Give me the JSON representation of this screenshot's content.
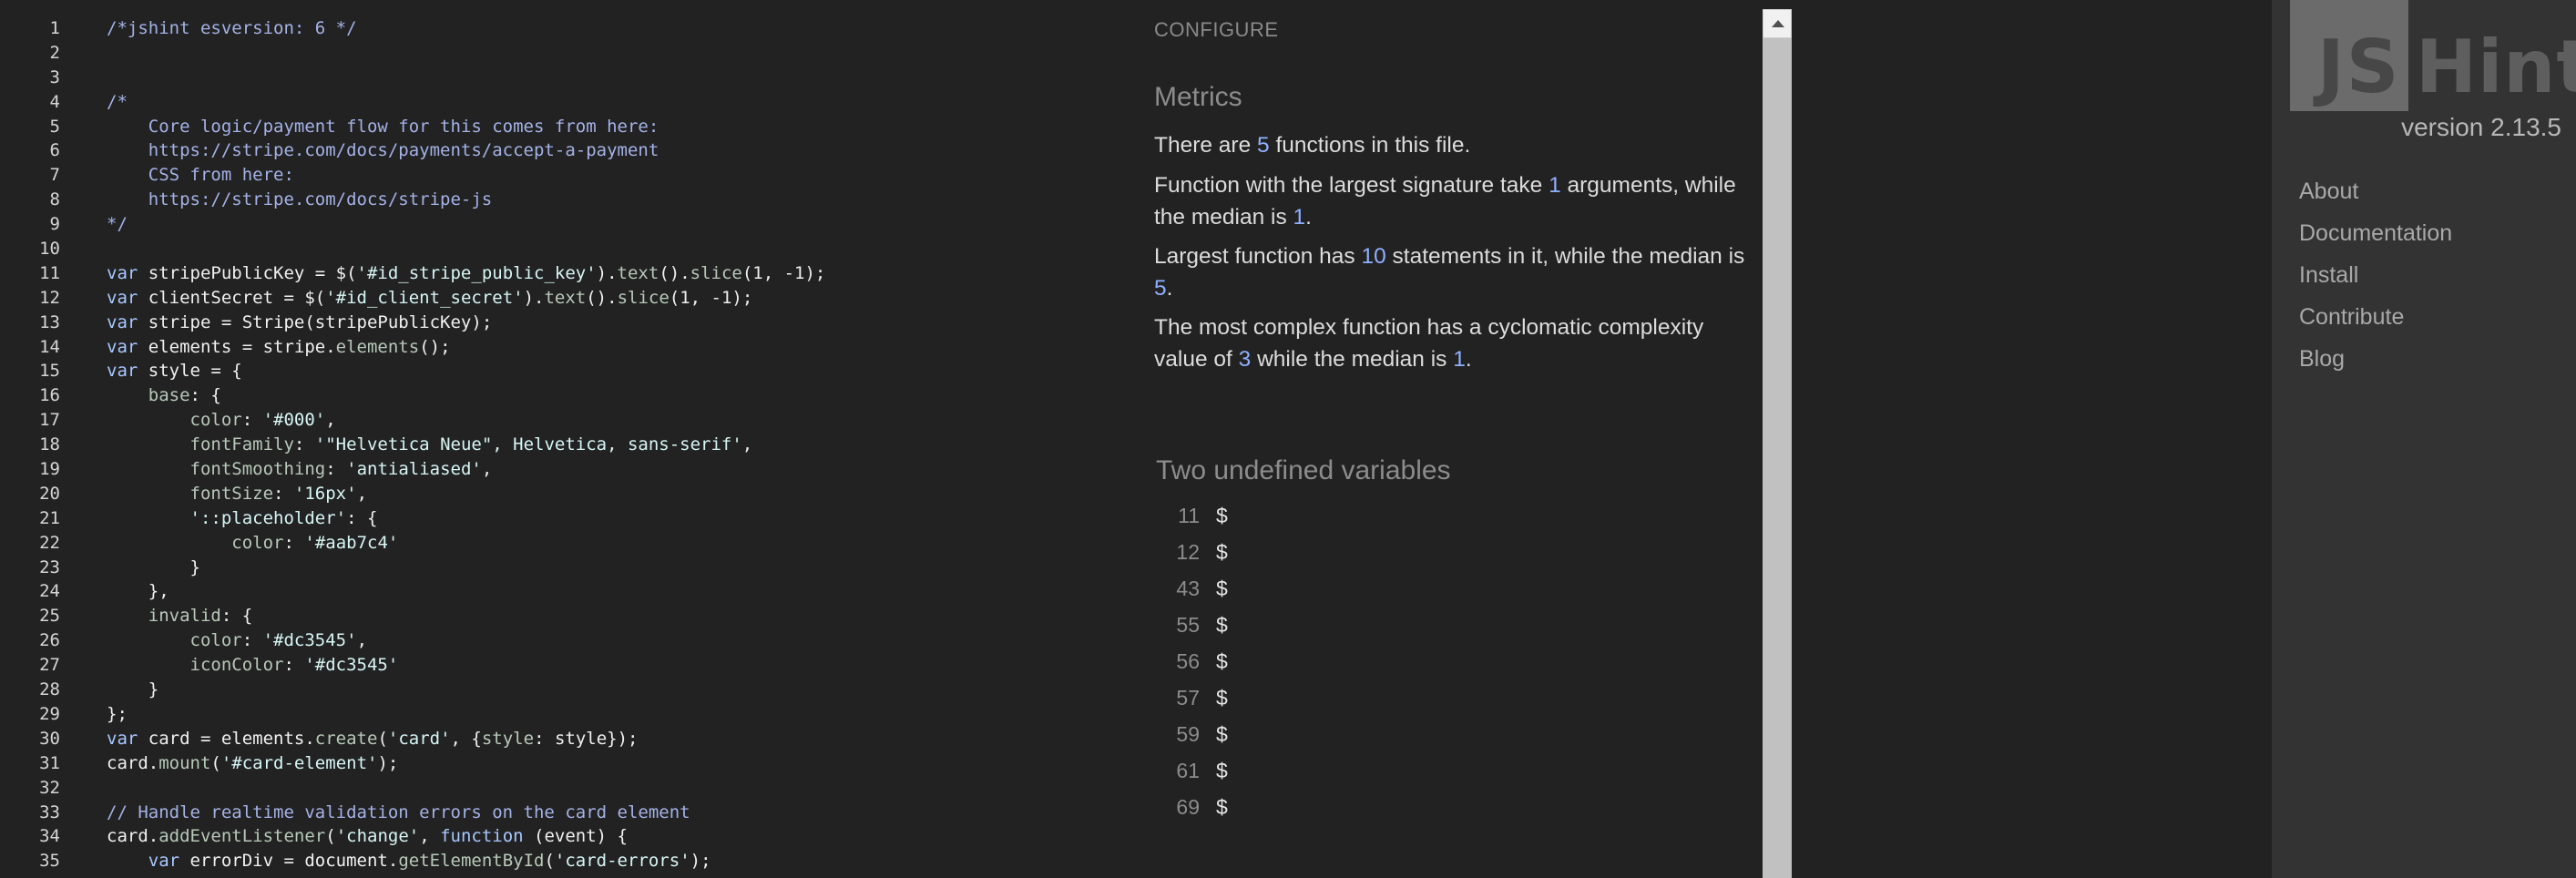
{
  "editor": {
    "lines": [
      {
        "n": "1",
        "parts": [
          [
            "cm",
            "/*jshint esversion: 6 */"
          ]
        ]
      },
      {
        "n": "2",
        "parts": []
      },
      {
        "n": "3",
        "parts": []
      },
      {
        "n": "4",
        "parts": [
          [
            "cm",
            "/*"
          ]
        ]
      },
      {
        "n": "5",
        "parts": [
          [
            "cm",
            "    Core logic/payment flow for this comes from here:"
          ]
        ]
      },
      {
        "n": "6",
        "parts": [
          [
            "cm",
            "    https://stripe.com/docs/payments/accept-a-payment"
          ]
        ]
      },
      {
        "n": "7",
        "parts": [
          [
            "cm",
            "    CSS from here:"
          ]
        ]
      },
      {
        "n": "8",
        "parts": [
          [
            "cm",
            "    https://stripe.com/docs/stripe-js"
          ]
        ]
      },
      {
        "n": "9",
        "parts": [
          [
            "cm",
            "*/"
          ]
        ]
      },
      {
        "n": "10",
        "parts": []
      },
      {
        "n": "11",
        "parts": [
          [
            "kw",
            "var"
          ],
          [
            "",
            " stripePublicKey = $("
          ],
          [
            "st",
            "'#id_stripe_public_key'"
          ],
          [
            "",
            ")."
          ],
          [
            "pr",
            "text"
          ],
          [
            "",
            "()."
          ],
          [
            "pr",
            "slice"
          ],
          [
            "",
            "(1, -1);"
          ]
        ]
      },
      {
        "n": "12",
        "parts": [
          [
            "kw",
            "var"
          ],
          [
            "",
            " clientSecret = $("
          ],
          [
            "st",
            "'#id_client_secret'"
          ],
          [
            "",
            ")."
          ],
          [
            "pr",
            "text"
          ],
          [
            "",
            "()."
          ],
          [
            "pr",
            "slice"
          ],
          [
            "",
            "(1, -1);"
          ]
        ]
      },
      {
        "n": "13",
        "parts": [
          [
            "kw",
            "var"
          ],
          [
            "",
            " stripe = Stripe(stripePublicKey);"
          ]
        ]
      },
      {
        "n": "14",
        "parts": [
          [
            "kw",
            "var"
          ],
          [
            "",
            " elements = stripe."
          ],
          [
            "pr",
            "elements"
          ],
          [
            "",
            "();"
          ]
        ]
      },
      {
        "n": "15",
        "parts": [
          [
            "kw",
            "var"
          ],
          [
            "",
            " style = {"
          ]
        ]
      },
      {
        "n": "16",
        "parts": [
          [
            "",
            "    "
          ],
          [
            "pr",
            "base"
          ],
          [
            "",
            ": {"
          ]
        ]
      },
      {
        "n": "17",
        "parts": [
          [
            "",
            "        "
          ],
          [
            "pr",
            "color"
          ],
          [
            "",
            ": "
          ],
          [
            "st",
            "'#000'"
          ],
          [
            "",
            ","
          ]
        ]
      },
      {
        "n": "18",
        "parts": [
          [
            "",
            "        "
          ],
          [
            "pr",
            "fontFamily"
          ],
          [
            "",
            ": "
          ],
          [
            "st",
            "'\"Helvetica Neue\", Helvetica, sans-serif'"
          ],
          [
            "",
            ","
          ]
        ]
      },
      {
        "n": "19",
        "parts": [
          [
            "",
            "        "
          ],
          [
            "pr",
            "fontSmoothing"
          ],
          [
            "",
            ": "
          ],
          [
            "st",
            "'antialiased'"
          ],
          [
            "",
            ","
          ]
        ]
      },
      {
        "n": "20",
        "parts": [
          [
            "",
            "        "
          ],
          [
            "pr",
            "fontSize"
          ],
          [
            "",
            ": "
          ],
          [
            "st",
            "'16px'"
          ],
          [
            "",
            ","
          ]
        ]
      },
      {
        "n": "21",
        "parts": [
          [
            "",
            "        "
          ],
          [
            "st",
            "'::placeholder'"
          ],
          [
            "",
            ": {"
          ]
        ]
      },
      {
        "n": "22",
        "parts": [
          [
            "",
            "            "
          ],
          [
            "pr",
            "color"
          ],
          [
            "",
            ": "
          ],
          [
            "st",
            "'#aab7c4'"
          ]
        ]
      },
      {
        "n": "23",
        "parts": [
          [
            "",
            "        }"
          ]
        ]
      },
      {
        "n": "24",
        "parts": [
          [
            "",
            "    },"
          ]
        ]
      },
      {
        "n": "25",
        "parts": [
          [
            "",
            "    "
          ],
          [
            "pr",
            "invalid"
          ],
          [
            "",
            ": {"
          ]
        ]
      },
      {
        "n": "26",
        "parts": [
          [
            "",
            "        "
          ],
          [
            "pr",
            "color"
          ],
          [
            "",
            ": "
          ],
          [
            "st",
            "'#dc3545'"
          ],
          [
            "",
            ","
          ]
        ]
      },
      {
        "n": "27",
        "parts": [
          [
            "",
            "        "
          ],
          [
            "pr",
            "iconColor"
          ],
          [
            "",
            ": "
          ],
          [
            "st",
            "'#dc3545'"
          ]
        ]
      },
      {
        "n": "28",
        "parts": [
          [
            "",
            "    }"
          ]
        ]
      },
      {
        "n": "29",
        "parts": [
          [
            "",
            "};"
          ]
        ]
      },
      {
        "n": "30",
        "parts": [
          [
            "kw",
            "var"
          ],
          [
            "",
            " card = elements."
          ],
          [
            "pr",
            "create"
          ],
          [
            "",
            "("
          ],
          [
            "st",
            "'card'"
          ],
          [
            "",
            ", {"
          ],
          [
            "pr",
            "style"
          ],
          [
            "",
            ": style});"
          ]
        ]
      },
      {
        "n": "31",
        "parts": [
          [
            "",
            "card."
          ],
          [
            "pr",
            "mount"
          ],
          [
            "",
            "("
          ],
          [
            "st",
            "'#card-element'"
          ],
          [
            "",
            ");"
          ]
        ]
      },
      {
        "n": "32",
        "parts": []
      },
      {
        "n": "33",
        "parts": [
          [
            "cm",
            "// Handle realtime validation errors on the card element"
          ]
        ]
      },
      {
        "n": "34",
        "parts": [
          [
            "",
            "card."
          ],
          [
            "pr",
            "addEventListener"
          ],
          [
            "",
            "("
          ],
          [
            "st",
            "'change'"
          ],
          [
            "",
            ", "
          ],
          [
            "kw",
            "function"
          ],
          [
            "",
            " (event) {"
          ]
        ]
      },
      {
        "n": "35",
        "parts": [
          [
            "",
            "    "
          ],
          [
            "kw",
            "var"
          ],
          [
            "",
            " errorDiv = document."
          ],
          [
            "pr",
            "getElementById"
          ],
          [
            "",
            "("
          ],
          [
            "st",
            "'card-errors'"
          ],
          [
            "",
            ");"
          ]
        ]
      }
    ]
  },
  "report": {
    "configure_label": "CONFIGURE",
    "metrics_heading": "Metrics",
    "metrics": {
      "functions_count": {
        "pre": "There are ",
        "num": "5",
        "post": " functions in this file."
      },
      "largest_signature": {
        "pre": "Function with the largest signature take ",
        "num1": "1",
        "mid": " arguments, while the median is ",
        "num2": "1",
        "post": "."
      },
      "largest_function": {
        "pre": "Largest function has ",
        "num1": "10",
        "mid": " statements in it, while the median is ",
        "num2": "5",
        "post": "."
      },
      "complexity": {
        "pre": "The most complex function has a cyclomatic complexity value of ",
        "num1": "3",
        "mid": " while the median is ",
        "num2": "1",
        "post": "."
      }
    },
    "undefined_heading": "Two undefined variables",
    "undefined_vars": [
      {
        "line": "11",
        "name": "$"
      },
      {
        "line": "12",
        "name": "$"
      },
      {
        "line": "43",
        "name": "$"
      },
      {
        "line": "55",
        "name": "$"
      },
      {
        "line": "56",
        "name": "$"
      },
      {
        "line": "57",
        "name": "$"
      },
      {
        "line": "59",
        "name": "$"
      },
      {
        "line": "61",
        "name": "$"
      },
      {
        "line": "69",
        "name": "$"
      }
    ]
  },
  "sidebar": {
    "logo_left": "JS",
    "logo_right": "Hint",
    "version": "version 2.13.5",
    "nav": [
      {
        "label": "About"
      },
      {
        "label": "Documentation"
      },
      {
        "label": "Install"
      },
      {
        "label": "Contribute"
      },
      {
        "label": "Blog"
      }
    ]
  },
  "colors": {
    "background": "#222222",
    "sidebar": "#333333",
    "comment": "#a4b2e6",
    "keyword": "#a8c8ff",
    "string": "#d7f5f5",
    "number_highlight": "#8fb0ff"
  }
}
